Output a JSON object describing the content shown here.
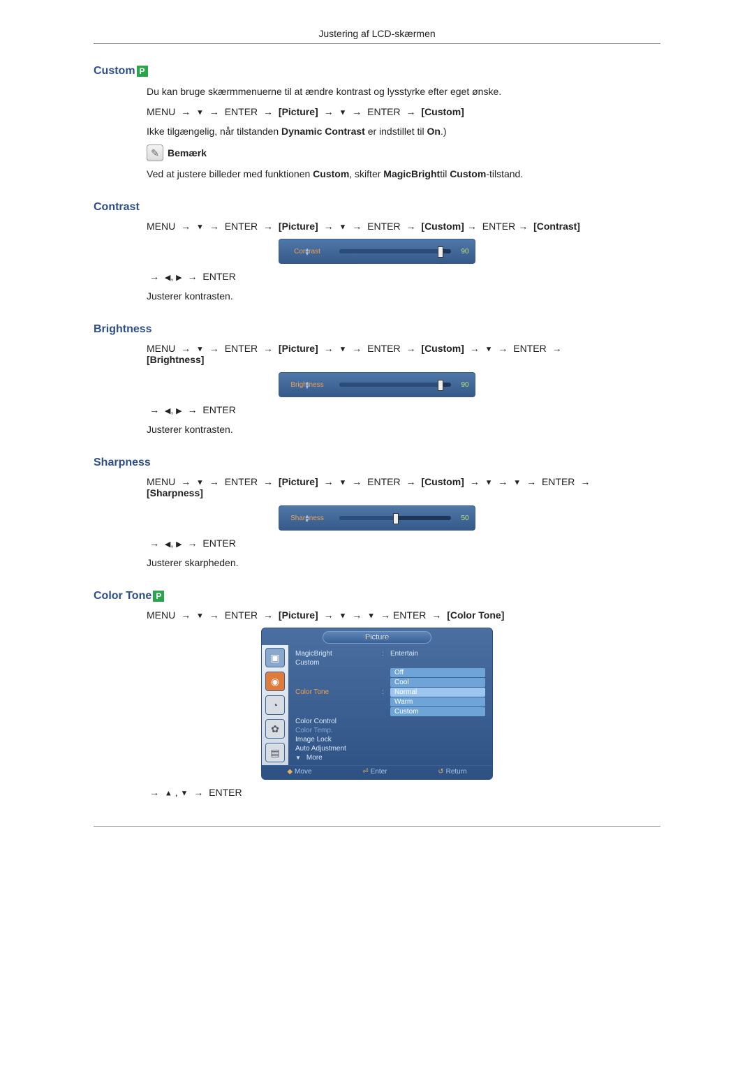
{
  "header": {
    "title": "Justering af LCD-skærmen"
  },
  "badges": {
    "p": "P"
  },
  "sections": {
    "custom": {
      "title": "Custom",
      "intro": "Du kan bruge skærmmenuerne til at ændre kontrast og lysstyrke efter eget ønske.",
      "path_menu": "MENU",
      "path_enter": "ENTER",
      "path_picture": "[Picture]",
      "path_custom": "[Custom]",
      "not_available_pre": "Ikke tilgængelig, når tilstanden ",
      "not_available_dc": "Dynamic Contrast",
      "not_available_mid": " er indstillet til ",
      "not_available_on": "On",
      "not_available_post": ".)",
      "note_label": "Bemærk",
      "note_text_pre": "Ved at justere billeder med funktionen ",
      "note_text_custom": "Custom",
      "note_text_mid": ", skifter ",
      "note_text_mb": "MagicBright",
      "note_text_til": "til ",
      "note_text_custom2": "Custom",
      "note_text_post": "-tilstand."
    },
    "contrast": {
      "title": "Contrast",
      "path_contrast": "[Contrast]",
      "osd_label": "Contrast",
      "osd_value": "90",
      "adjust_enter": "ENTER",
      "desc": "Justerer kontrasten."
    },
    "brightness": {
      "title": "Brightness",
      "path_brightness": "[Brightness]",
      "osd_label": "Brightness",
      "osd_value": "90",
      "adjust_enter": "ENTER",
      "desc": "Justerer kontrasten."
    },
    "sharpness": {
      "title": "Sharpness",
      "path_sharpness": "[Sharpness]",
      "osd_label": "Sharpness",
      "osd_value": "50",
      "adjust_enter": "ENTER",
      "desc": "Justerer skarpheden."
    },
    "colortone": {
      "title": "Color Tone",
      "path_colortone": "[Color Tone]",
      "menu_title": "Picture",
      "items": {
        "magicbright": "MagicBright",
        "magicbright_val": "Entertain",
        "custom": "Custom",
        "colortone": "Color Tone",
        "colorcontrol": "Color Control",
        "colortemp": "Color Temp.",
        "imagelock": "Image Lock",
        "autoadj": "Auto Adjustment",
        "more": "More"
      },
      "options": {
        "off": "Off",
        "cool": "Cool",
        "normal": "Normal",
        "warm": "Warm",
        "custom": "Custom"
      },
      "footer": {
        "move": "Move",
        "enter": "Enter",
        "return": "Return"
      },
      "adjust_enter": "ENTER"
    }
  }
}
